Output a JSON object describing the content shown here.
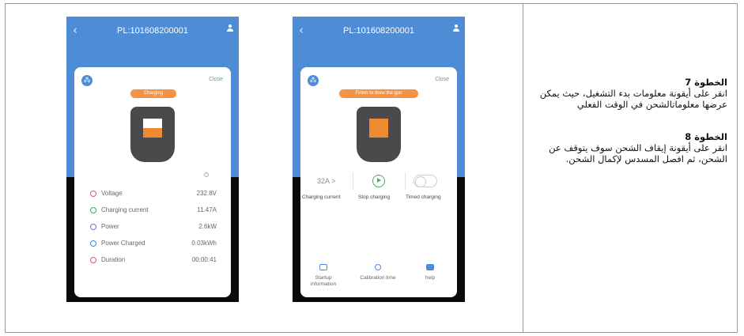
{
  "colors": {
    "blue": "#4e8dd6",
    "orange": "#f49444",
    "green": "#4aa86a",
    "black": "#0a0a0a"
  },
  "phone1": {
    "title": "PL:101608200001",
    "close": "Close",
    "status_pill": "Charging",
    "stats": [
      {
        "label": "Voltage",
        "value": "232.8V",
        "icon": "voltage-icon",
        "color": "#e05a6a"
      },
      {
        "label": "Charging current",
        "value": "11.47A",
        "icon": "current-icon",
        "color": "#3aaa60"
      },
      {
        "label": "Power",
        "value": "2.6kW",
        "icon": "power-icon",
        "color": "#9a5bd6"
      },
      {
        "label": "Power Charged",
        "value": "0.03kWh",
        "icon": "energy-icon",
        "color": "#3a8ee0"
      },
      {
        "label": "Duration",
        "value": "00:00:41",
        "icon": "clock-icon",
        "color": "#e05a6a"
      }
    ]
  },
  "phone2": {
    "title": "PL:101608200001",
    "close": "Close",
    "status_pill": "Finish to draw the gun",
    "amp": "32A >",
    "controls": [
      "Charging current",
      "Stop charging",
      "Timed charging"
    ],
    "bottom": [
      {
        "label": "Startup information",
        "icon": "info-icon"
      },
      {
        "label": "Calibration time",
        "icon": "calibration-icon"
      },
      {
        "label": "help",
        "icon": "help-icon"
      }
    ]
  },
  "steps": [
    {
      "title": "الخطوة 7",
      "text": "انقر على أيقونة معلومات بدء التشغيل، حيث يمكن عرضها معلوماتالشحن في الوقت الفعلي"
    },
    {
      "title": "الخطوة 8",
      "text": "انقر على أيقونة إيقاف الشحن سوف يتوقف عن الشحن، ثم افصل المسدس لإكمال الشحن."
    }
  ]
}
